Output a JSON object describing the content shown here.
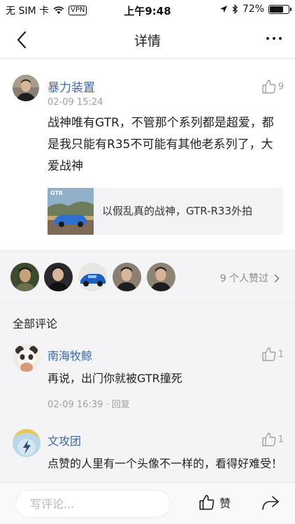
{
  "status_bar": {
    "carrier": "无 SIM 卡",
    "vpn": "VPN",
    "time": "上午9:48",
    "battery": "72%",
    "battery_level": 0.72
  },
  "nav": {
    "title": "详情"
  },
  "post": {
    "author": "暴力装置",
    "time": "02-09 15:24",
    "likes": "9",
    "text": "战神唯有GTR，不管那个系列都是超爱，都是我只能有R35不可能有其他老系列了，大爱战神",
    "link": {
      "thumb_label": "GTR",
      "title": "以假乱真的战神，GTR-R33外拍"
    }
  },
  "likers": {
    "count_text": "9 个人赞过"
  },
  "comments_section": {
    "title": "全部评论",
    "comments": [
      {
        "author": "南海牧鲸",
        "likes": "1",
        "text": "再说，出门你就被GTR撞死",
        "time": "02-09 16:39",
        "reply": "回复"
      },
      {
        "author": "文攻团",
        "likes": "1",
        "text": "点赞的人里有一个头像不一样的，看得好难受！"
      }
    ]
  },
  "bottom_bar": {
    "input_placeholder": "写评论...",
    "like_label": "赞"
  },
  "colors": {
    "link_blue": "#3a6aa8",
    "meta_gray": "#a0a0a0",
    "section_bg": "#f4f4f6"
  }
}
